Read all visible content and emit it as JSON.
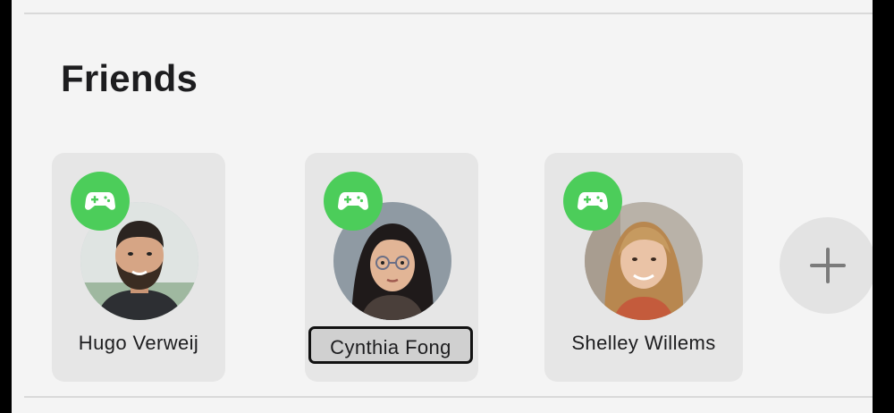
{
  "section": {
    "title": "Friends"
  },
  "friends": [
    {
      "name": "Hugo Verweij",
      "status_icon": "game-controller-icon",
      "focused": false
    },
    {
      "name": "Cynthia Fong",
      "status_icon": "game-controller-icon",
      "focused": true
    },
    {
      "name": "Shelley Willems",
      "status_icon": "game-controller-icon",
      "focused": false
    }
  ],
  "add_button": {
    "icon": "plus-icon"
  },
  "colors": {
    "badge": "#4ccd5a",
    "card": "#e6e6e6",
    "panel": "#f4f4f4",
    "focus_ring": "#111111"
  }
}
